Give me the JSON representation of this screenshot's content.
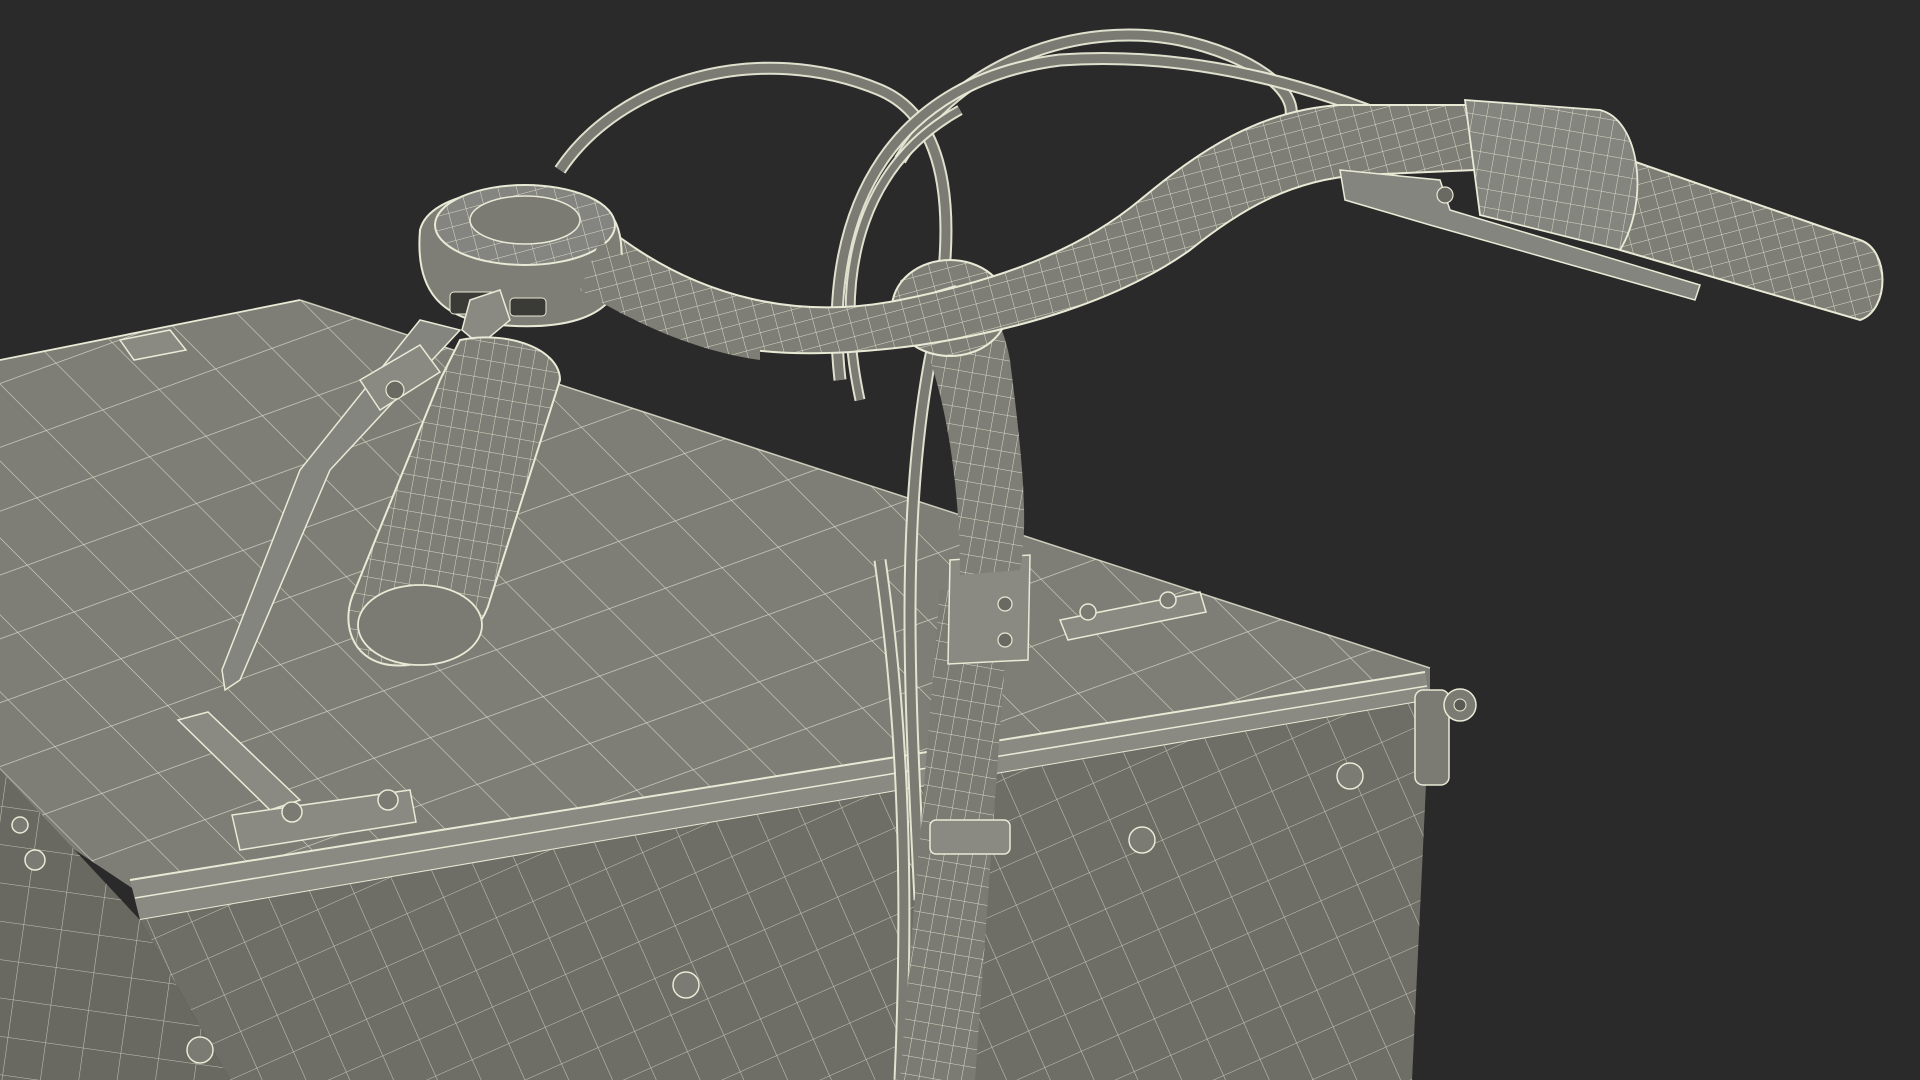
{
  "scene": {
    "subject": "cargo-bike-handlebar-wireframe",
    "render_mode": "wireframe",
    "colors": {
      "background": "#2a2a2a",
      "surface": "#7b7b73",
      "surface_dark": "#6a6a62",
      "surface_light": "#8a8a82",
      "wire": "#e9ead6",
      "wire_dim": "#cfd0be"
    }
  }
}
